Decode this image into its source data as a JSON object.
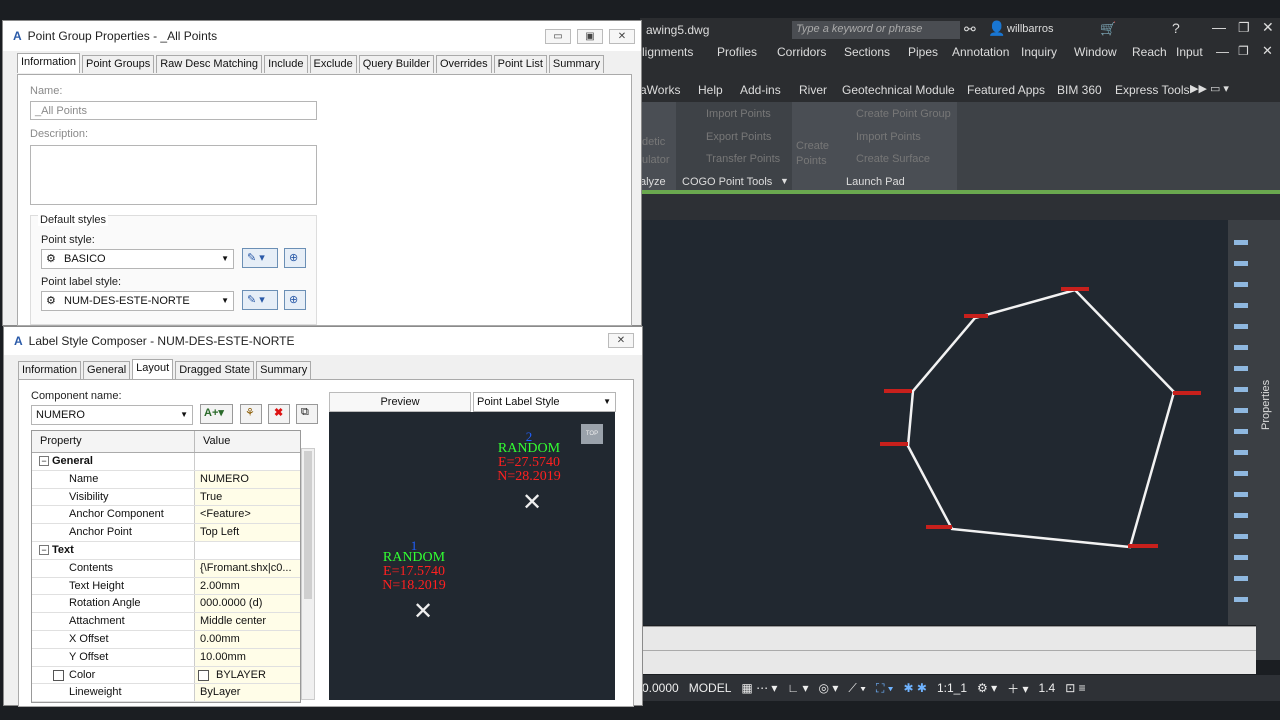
{
  "acad": {
    "file_title": "awing5.dwg",
    "search_placeholder": "Type a keyword or phrase",
    "user": "willbarros",
    "menu1": [
      "lignments",
      "Profiles",
      "Corridors",
      "Sections",
      "Pipes",
      "Annotation",
      "Inquiry",
      "Window",
      "Reach",
      "Input"
    ],
    "menu2": [
      "aWorks",
      "Help",
      "Add-ins",
      "River",
      "Geotechnical Module",
      "Featured Apps",
      "BIM 360",
      "Express Tools"
    ],
    "ribbon": {
      "analyze_label": "alyze",
      "analyze_lines": [
        "detic",
        "ulator"
      ],
      "cogo_label": "COGO Point Tools",
      "cogo_items": [
        "Import Points",
        "Export Points",
        "Transfer Points"
      ],
      "create_points": [
        "Create",
        "Points"
      ],
      "launch_items": [
        "Create Point Group",
        "Import Points",
        "Create Surface"
      ],
      "launch_label": "Launch Pad"
    },
    "status": {
      "coord": "0.0000",
      "model": "MODEL",
      "scale": "1:1_1",
      "zoom": "1.4"
    },
    "properties_label": "Properties"
  },
  "dialog1": {
    "title": "Point Group Properties - _All Points",
    "tabs": [
      "Information",
      "Point Groups",
      "Raw Desc Matching",
      "Include",
      "Exclude",
      "Query Builder",
      "Overrides",
      "Point List",
      "Summary"
    ],
    "name_label": "Name:",
    "name_value": "_All Points",
    "description_label": "Description:",
    "default_styles_label": "Default styles",
    "point_style_label": "Point style:",
    "point_style_value": "BASICO",
    "point_label_style_label": "Point label style:",
    "point_label_style_value": "NUM-DES-ESTE-NORTE"
  },
  "dialog2": {
    "title": "Label Style Composer - NUM-DES-ESTE-NORTE",
    "tabs": [
      "Information",
      "General",
      "Layout",
      "Dragged State",
      "Summary"
    ],
    "component_name_label": "Component name:",
    "component_name_value": "NUMERO",
    "preview_label": "Preview",
    "preview_select": "Point Label Style",
    "grid_headers": [
      "Property",
      "Value"
    ],
    "grid": [
      {
        "cat": "General"
      },
      {
        "p": "Name",
        "v": "NUMERO"
      },
      {
        "p": "Visibility",
        "v": "True"
      },
      {
        "p": "Anchor Component",
        "v": "<Feature>"
      },
      {
        "p": "Anchor Point",
        "v": "Top Left"
      },
      {
        "cat": "Text"
      },
      {
        "p": "Contents",
        "v": "{\\Fromant.shx|c0..."
      },
      {
        "p": "Text Height",
        "v": "2.00mm"
      },
      {
        "p": "Rotation Angle",
        "v": "000.0000 (d)"
      },
      {
        "p": "Attachment",
        "v": "Middle center"
      },
      {
        "p": "X Offset",
        "v": "0.00mm"
      },
      {
        "p": "Y Offset",
        "v": "10.00mm"
      },
      {
        "p": "Color",
        "v": "BYLAYER"
      },
      {
        "p": "Lineweight",
        "v": "ByLayer"
      }
    ],
    "preview_points": [
      {
        "num": "2",
        "desc": "RANDOM",
        "e": "E=27.5740",
        "n": "N=28.2019"
      },
      {
        "num": "1",
        "desc": "RANDOM",
        "e": "E=17.5740",
        "n": "N=18.2019"
      }
    ],
    "top_badge": "TOP"
  }
}
